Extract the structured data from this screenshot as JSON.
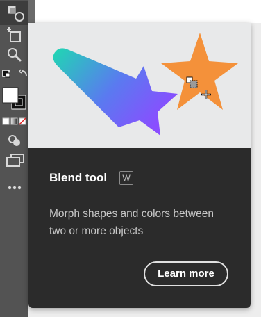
{
  "tooltip": {
    "title": "Blend tool",
    "shortcut": "W",
    "description": "Morph shapes and colors between two or more objects",
    "learn_more_label": "Learn more"
  },
  "toolbar": {
    "tools": [
      "blend-tool-icon",
      "artboard-tool-icon",
      "zoom-tool-icon",
      "swap-colors-icon",
      "fill-stroke-icon",
      "color-mode-icons",
      "draw-mode-icon",
      "screen-mode-icon",
      "more-tools-icon"
    ]
  },
  "colors": {
    "toolbar_bg": "#535353",
    "card_bg": "#2b2b2b",
    "preview_bg": "#e8e9ea",
    "star_orange": "#f4913a",
    "shooting_gradient_start": "#1fd8b2",
    "shooting_gradient_end": "#8a4dff"
  }
}
